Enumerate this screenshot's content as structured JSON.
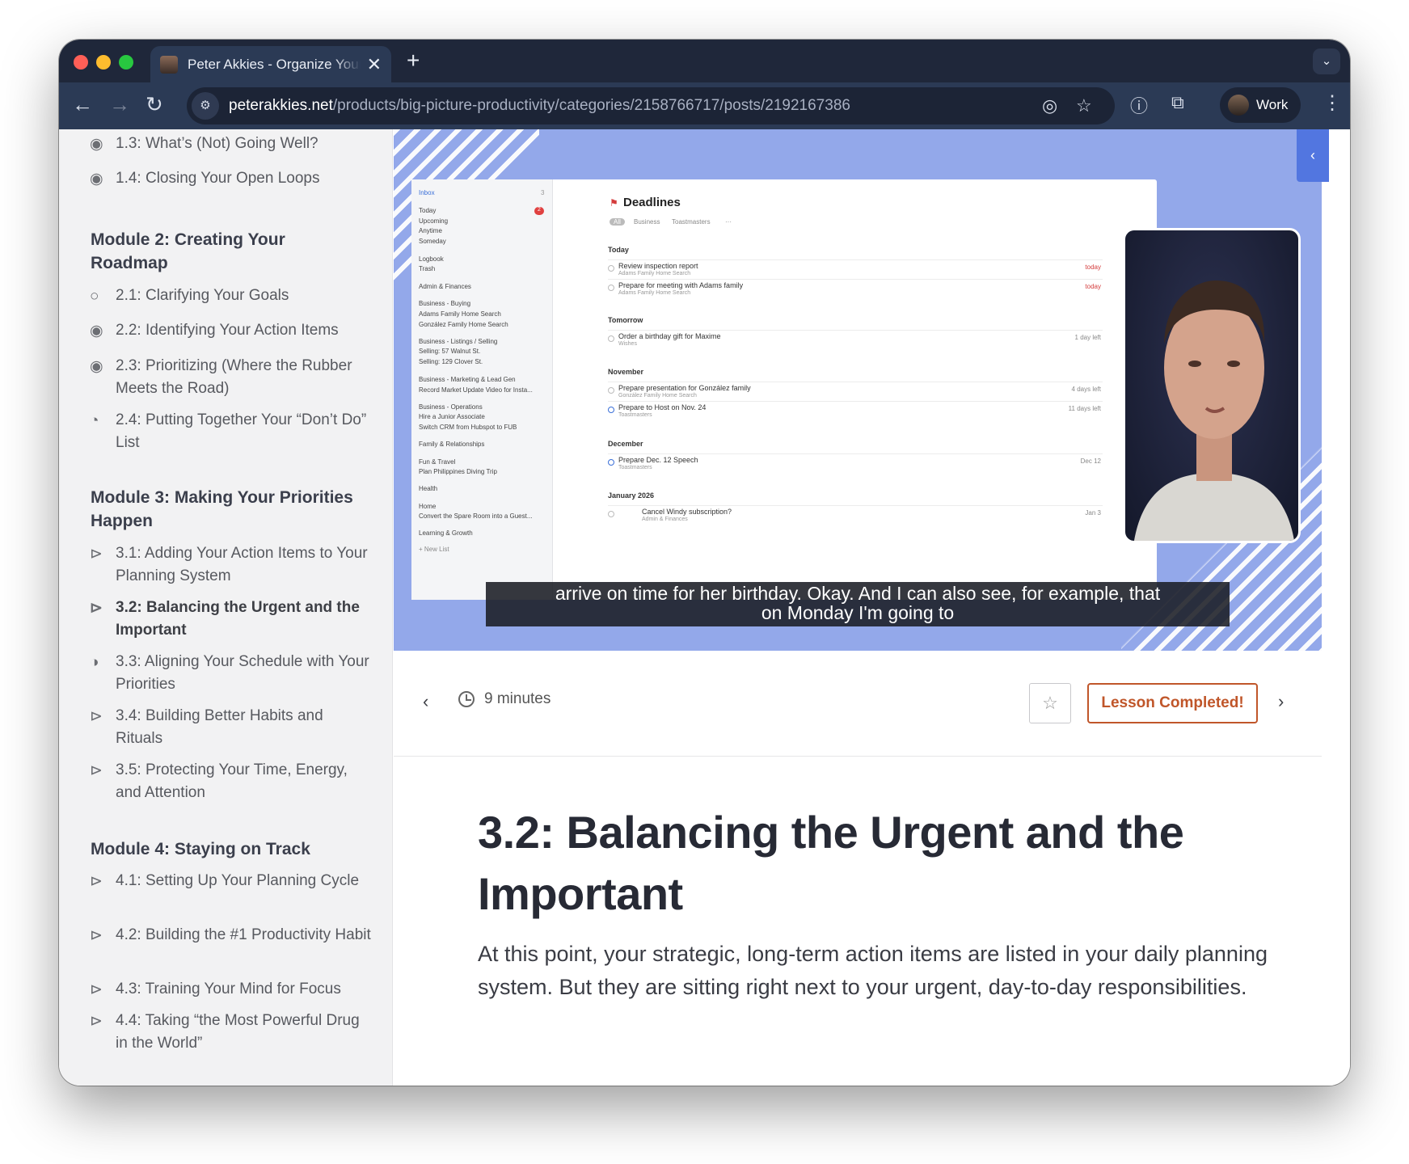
{
  "browser": {
    "tab_title": "Peter Akkies - Organize Your",
    "url_host": "peterakkies.net",
    "url_path": "/products/big-picture-productivity/categories/2158766717/posts/2192167386",
    "profile_label": "Work",
    "traffic_lights": [
      "#ff5f57",
      "#febc2e",
      "#28c840"
    ]
  },
  "sidebar": {
    "items": [
      {
        "type": "lesson",
        "label": "1.3: What’s (Not) Going Well?",
        "status": "completed",
        "icon": "check-circle-icon"
      },
      {
        "type": "lesson",
        "label": "1.4: Closing Your Open Loops",
        "status": "completed",
        "icon": "check-circle-icon"
      },
      {
        "type": "module",
        "label": "Module 2: Creating Your Roadmap"
      },
      {
        "type": "lesson",
        "label": "2.1: Clarifying Your Goals",
        "status": "not-started",
        "icon": "empty-circle-icon"
      },
      {
        "type": "lesson",
        "label": "2.2: Identifying Your Action Items",
        "status": "completed",
        "icon": "check-circle-icon"
      },
      {
        "type": "lesson",
        "label": "2.3: Prioritizing (Where the Rubber Meets the Road)",
        "status": "completed",
        "icon": "check-circle-icon"
      },
      {
        "type": "lesson",
        "label": "2.4: Putting Together Your “Don’t Do” List",
        "status": "in-progress",
        "icon": "partial-circle-icon"
      },
      {
        "type": "module",
        "label": "Module 3: Making Your Priorities Happen"
      },
      {
        "type": "lesson",
        "label": "3.1: Adding Your Action Items to Your Planning System",
        "status": "video",
        "icon": "play-circle-icon"
      },
      {
        "type": "lesson",
        "label": "3.2: Balancing the Urgent and the Important",
        "status": "current",
        "icon": "play-circle-icon"
      },
      {
        "type": "lesson",
        "label": "3.3: Aligning Your Schedule with Your Priorities",
        "status": "in-progress",
        "icon": "partial-circle-icon"
      },
      {
        "type": "lesson",
        "label": "3.4: Building Better Habits and Rituals",
        "status": "video",
        "icon": "play-circle-icon"
      },
      {
        "type": "lesson",
        "label": "3.5: Protecting Your Time, Energy, and Attention",
        "status": "video",
        "icon": "play-circle-icon"
      },
      {
        "type": "module",
        "label": "Module 4: Staying on Track"
      },
      {
        "type": "lesson",
        "label": "4.1: Setting Up Your Planning Cycle",
        "status": "video",
        "icon": "play-circle-icon"
      },
      {
        "type": "lesson",
        "label": "4.2: Building the #1 Productivity Habit",
        "status": "video",
        "icon": "play-circle-icon"
      },
      {
        "type": "lesson",
        "label": "4.3: Training Your Mind for Focus",
        "status": "video",
        "icon": "play-circle-icon"
      },
      {
        "type": "lesson",
        "label": "4.4: Taking “the Most Powerful Drug in the World”",
        "status": "video",
        "icon": "play-circle-icon"
      }
    ]
  },
  "video": {
    "caption_line1": "arrive on time for her birthday. Okay. And I can also see, for example, that",
    "caption_line2": "on Monday I'm going to",
    "screen": {
      "title": "Deadlines",
      "filters": [
        "All",
        "Business",
        "Toastmasters",
        "···"
      ],
      "sidebar_items": [
        "Inbox",
        "Today",
        "Upcoming",
        "Anytime",
        "Someday",
        "Logbook",
        "Trash",
        "Admin & Finances",
        "Business - Buying",
        "Adams Family Home Search",
        "González Family Home Search",
        "Business - Listings / Selling",
        "Selling: 57 Walnut St.",
        "Selling: 129 Clover St.",
        "Business - Marketing & Lead Gen",
        "Record Market Update Video for Insta...",
        "Business - Operations",
        "Hire a Junior Associate",
        "Switch CRM from Hubspot to FUB",
        "Family & Relationships",
        "Fun & Travel",
        "Plan Philippines Diving Trip",
        "Health",
        "Home",
        "Convert the Spare Room into a Guest...",
        "Learning & Growth",
        "+ New List"
      ],
      "inbox_count": "3",
      "today_count": "2",
      "sections": [
        {
          "name": "Today",
          "tasks": [
            {
              "title": "Review inspection report",
              "sub": "Adams Family Home Search",
              "due": "today",
              "urgent": true
            },
            {
              "title": "Prepare for meeting with Adams family",
              "sub": "Adams Family Home Search",
              "due": "today",
              "urgent": true
            }
          ]
        },
        {
          "name": "Tomorrow",
          "tasks": [
            {
              "title": "Order a birthday gift for Maxime",
              "sub": "Wishes",
              "due": "1 day left",
              "urgent": false
            }
          ]
        },
        {
          "name": "November",
          "tasks": [
            {
              "title": "Prepare presentation for González family",
              "sub": "González Family Home Search",
              "due": "4 days left",
              "urgent": false
            },
            {
              "title": "Prepare to Host on Nov. 24",
              "sub": "Toastmasters",
              "due": "11 days left",
              "urgent": false
            }
          ]
        },
        {
          "name": "December",
          "tasks": [
            {
              "title": "Prepare Dec. 12 Speech",
              "sub": "Toastmasters",
              "due": "Dec 12",
              "urgent": false
            }
          ]
        },
        {
          "name": "January 2026",
          "tasks": [
            {
              "title": "Cancel Windy subscription?",
              "sub": "Admin & Finances",
              "due": "Jan 3",
              "urgent": false
            }
          ]
        }
      ]
    }
  },
  "controls": {
    "duration": "9 minutes",
    "complete_label": "Lesson Completed!",
    "accent": "#c0562a"
  },
  "article": {
    "title": "3.2: Balancing the Urgent and the Important",
    "paragraph": "At this point, your strategic, long-term action items are listed in your daily planning system. But they are sitting right next to your urgent, day-to-day responsibilities."
  }
}
